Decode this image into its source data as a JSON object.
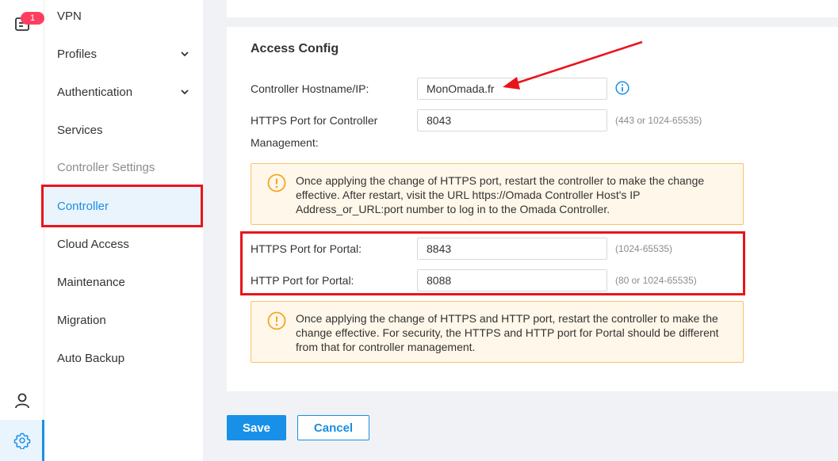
{
  "rail": {
    "notification_count": "1"
  },
  "menu": {
    "items": [
      {
        "label": "VPN"
      },
      {
        "label": "Profiles"
      },
      {
        "label": "Authentication"
      },
      {
        "label": "Services"
      },
      {
        "label": "Controller Settings"
      },
      {
        "label": "Controller"
      },
      {
        "label": "Cloud Access"
      },
      {
        "label": "Maintenance"
      },
      {
        "label": "Migration"
      },
      {
        "label": "Auto Backup"
      }
    ]
  },
  "access_config": {
    "title": "Access Config",
    "hostname_label": "Controller Hostname/IP:",
    "hostname_value": "MonOmada.fr",
    "https_mgmt_label_line1": "HTTPS Port for Controller",
    "https_mgmt_label_line2": "Management:",
    "https_mgmt_value": "8043",
    "https_mgmt_hint": "(443 or 1024-65535)",
    "notice1": "Once applying the change of HTTPS port, restart the controller to make the change effective. After restart, visit the URL https://Omada Controller Host's IP Address_or_URL:port number to log in to the Omada Controller.",
    "https_portal_label": "HTTPS Port for Portal:",
    "https_portal_value": "8843",
    "https_portal_hint": "(1024-65535)",
    "http_portal_label": "HTTP Port for Portal:",
    "http_portal_value": "8088",
    "http_portal_hint": "(80 or 1024-65535)",
    "notice2": "Once applying the change of HTTPS and HTTP port, restart the controller to make the change effective. For security, the HTTPS and HTTP port for Portal should be different from that for controller management."
  },
  "actions": {
    "save_label": "Save",
    "cancel_label": "Cancel"
  },
  "colors": {
    "accent": "#1890e8",
    "highlight_red": "#e8151b",
    "warning_border": "#f7c46c",
    "warning_bg": "#fff7e9"
  }
}
